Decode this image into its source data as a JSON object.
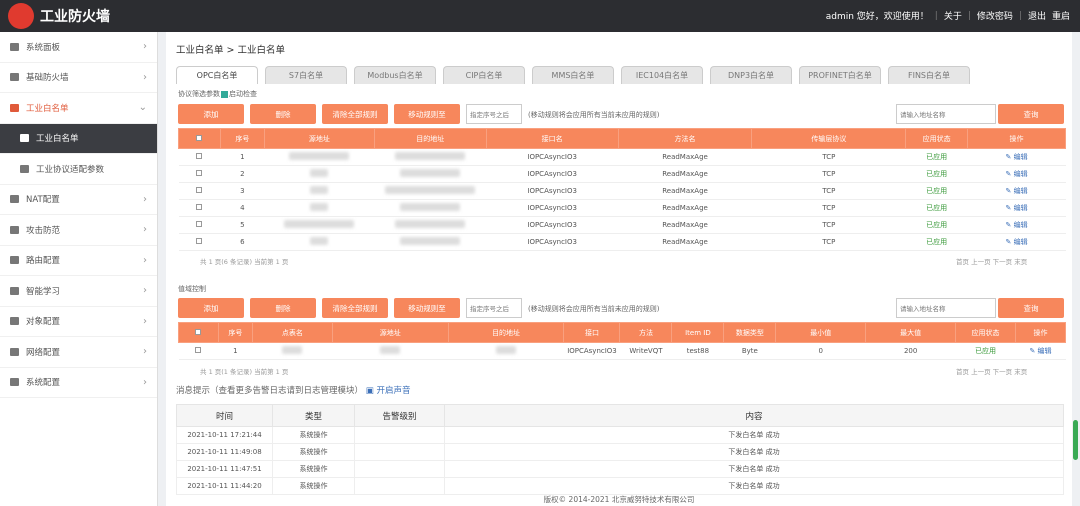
{
  "app": {
    "title": "工业防火墙",
    "logo": "flame-logo-icon"
  },
  "topbar": {
    "greeting": "admin 您好，欢迎使用！",
    "about": "关于",
    "change_password": "修改密码",
    "logout": "退出",
    "restart": "重启"
  },
  "sidebar": {
    "items": [
      {
        "label": "系统面板",
        "icon": "dashboard-icon"
      },
      {
        "label": "基础防火墙",
        "icon": "firewall-icon"
      },
      {
        "label": "工业白名单",
        "icon": "whitelist-icon"
      },
      {
        "label": "工业白名单",
        "icon": "list-icon"
      },
      {
        "label": "工业协议适配参数",
        "icon": "protocol-icon"
      },
      {
        "label": "NAT配置",
        "icon": "nat-icon"
      },
      {
        "label": "攻击防范",
        "icon": "shield-icon"
      },
      {
        "label": "路由配置",
        "icon": "route-icon"
      },
      {
        "label": "智能学习",
        "icon": "learning-icon"
      },
      {
        "label": "对象配置",
        "icon": "object-icon"
      },
      {
        "label": "网络配置",
        "icon": "network-icon"
      },
      {
        "label": "系统配置",
        "icon": "settings-icon"
      }
    ]
  },
  "breadcrumb": "工业白名单 > 工业白名单",
  "tabs": [
    "OPC白名单",
    "S7白名单",
    "Modbus白名单",
    "CIP白名单",
    "MMS白名单",
    "IEC104白名单",
    "DNP3白名单",
    "PROFINET白名单",
    "FINS白名单"
  ],
  "section1": {
    "label": "协议筛选参数",
    "check": "启动检查"
  },
  "toolbar": {
    "add": "添加",
    "delete": "删除",
    "clear_all": "清除全部规则",
    "move": "移动规则至",
    "seq_placeholder": "指定序号之后",
    "hint": "(移动规则将会应用所有当前未应用的规则)",
    "search_placeholder": "请输入地址名称",
    "query": "查询"
  },
  "table1": {
    "headers": [
      "序号",
      "源地址",
      "目的地址",
      "接口名",
      "方法名",
      "传输层协议",
      "应用状态",
      "操作"
    ],
    "rows": [
      {
        "no": "1",
        "iface": "IOPCAsyncIO3",
        "method": "ReadMaxAge",
        "proto": "TCP",
        "status": "已应用",
        "op": "编辑"
      },
      {
        "no": "2",
        "iface": "IOPCAsyncIO3",
        "method": "ReadMaxAge",
        "proto": "TCP",
        "status": "已应用",
        "op": "编辑"
      },
      {
        "no": "3",
        "iface": "IOPCAsyncIO3",
        "method": "ReadMaxAge",
        "proto": "TCP",
        "status": "已应用",
        "op": "编辑"
      },
      {
        "no": "4",
        "iface": "IOPCAsyncIO3",
        "method": "ReadMaxAge",
        "proto": "TCP",
        "status": "已应用",
        "op": "编辑"
      },
      {
        "no": "5",
        "iface": "IOPCAsyncIO3",
        "method": "ReadMaxAge",
        "proto": "TCP",
        "status": "已应用",
        "op": "编辑"
      },
      {
        "no": "6",
        "iface": "IOPCAsyncIO3",
        "method": "ReadMaxAge",
        "proto": "TCP",
        "status": "已应用",
        "op": "编辑"
      }
    ],
    "pager": "共 1 页(6 条记录) 当前第 1 页",
    "nav": "首页 上一页 下一页 末页"
  },
  "section2": {
    "label": "值域控制"
  },
  "table2": {
    "headers": [
      "序号",
      "点表名",
      "源地址",
      "目的地址",
      "接口",
      "方法",
      "Item ID",
      "数据类型",
      "最小值",
      "最大值",
      "应用状态",
      "操作"
    ],
    "rows": [
      {
        "no": "1",
        "iface": "IOPCAsyncIO3",
        "method": "WriteVQT",
        "item": "test88",
        "dtype": "Byte",
        "min": "0",
        "max": "200",
        "status": "已应用",
        "op": "编辑"
      }
    ],
    "pager": "共 1 页(1 条记录) 当前第 1 页",
    "nav": "首页 上一页 下一页 末页"
  },
  "messages": {
    "title": "消息提示（查看更多告警日志请到日志管理模块）",
    "sound": "开启声音",
    "headers": [
      "时间",
      "类型",
      "告警级别",
      "内容"
    ],
    "rows": [
      {
        "time": "2021-10-11 17:21:44",
        "type": "系统操作",
        "content": "下发白名单 成功"
      },
      {
        "time": "2021-10-11 11:49:08",
        "type": "系统操作",
        "content": "下发白名单 成功"
      },
      {
        "time": "2021-10-11 11:47:51",
        "type": "系统操作",
        "content": "下发白名单 成功"
      },
      {
        "time": "2021-10-11 11:44:20",
        "type": "系统操作",
        "content": "下发白名单 成功"
      }
    ]
  },
  "footer": "版权© 2014-2021 北京威努特技术有限公司"
}
